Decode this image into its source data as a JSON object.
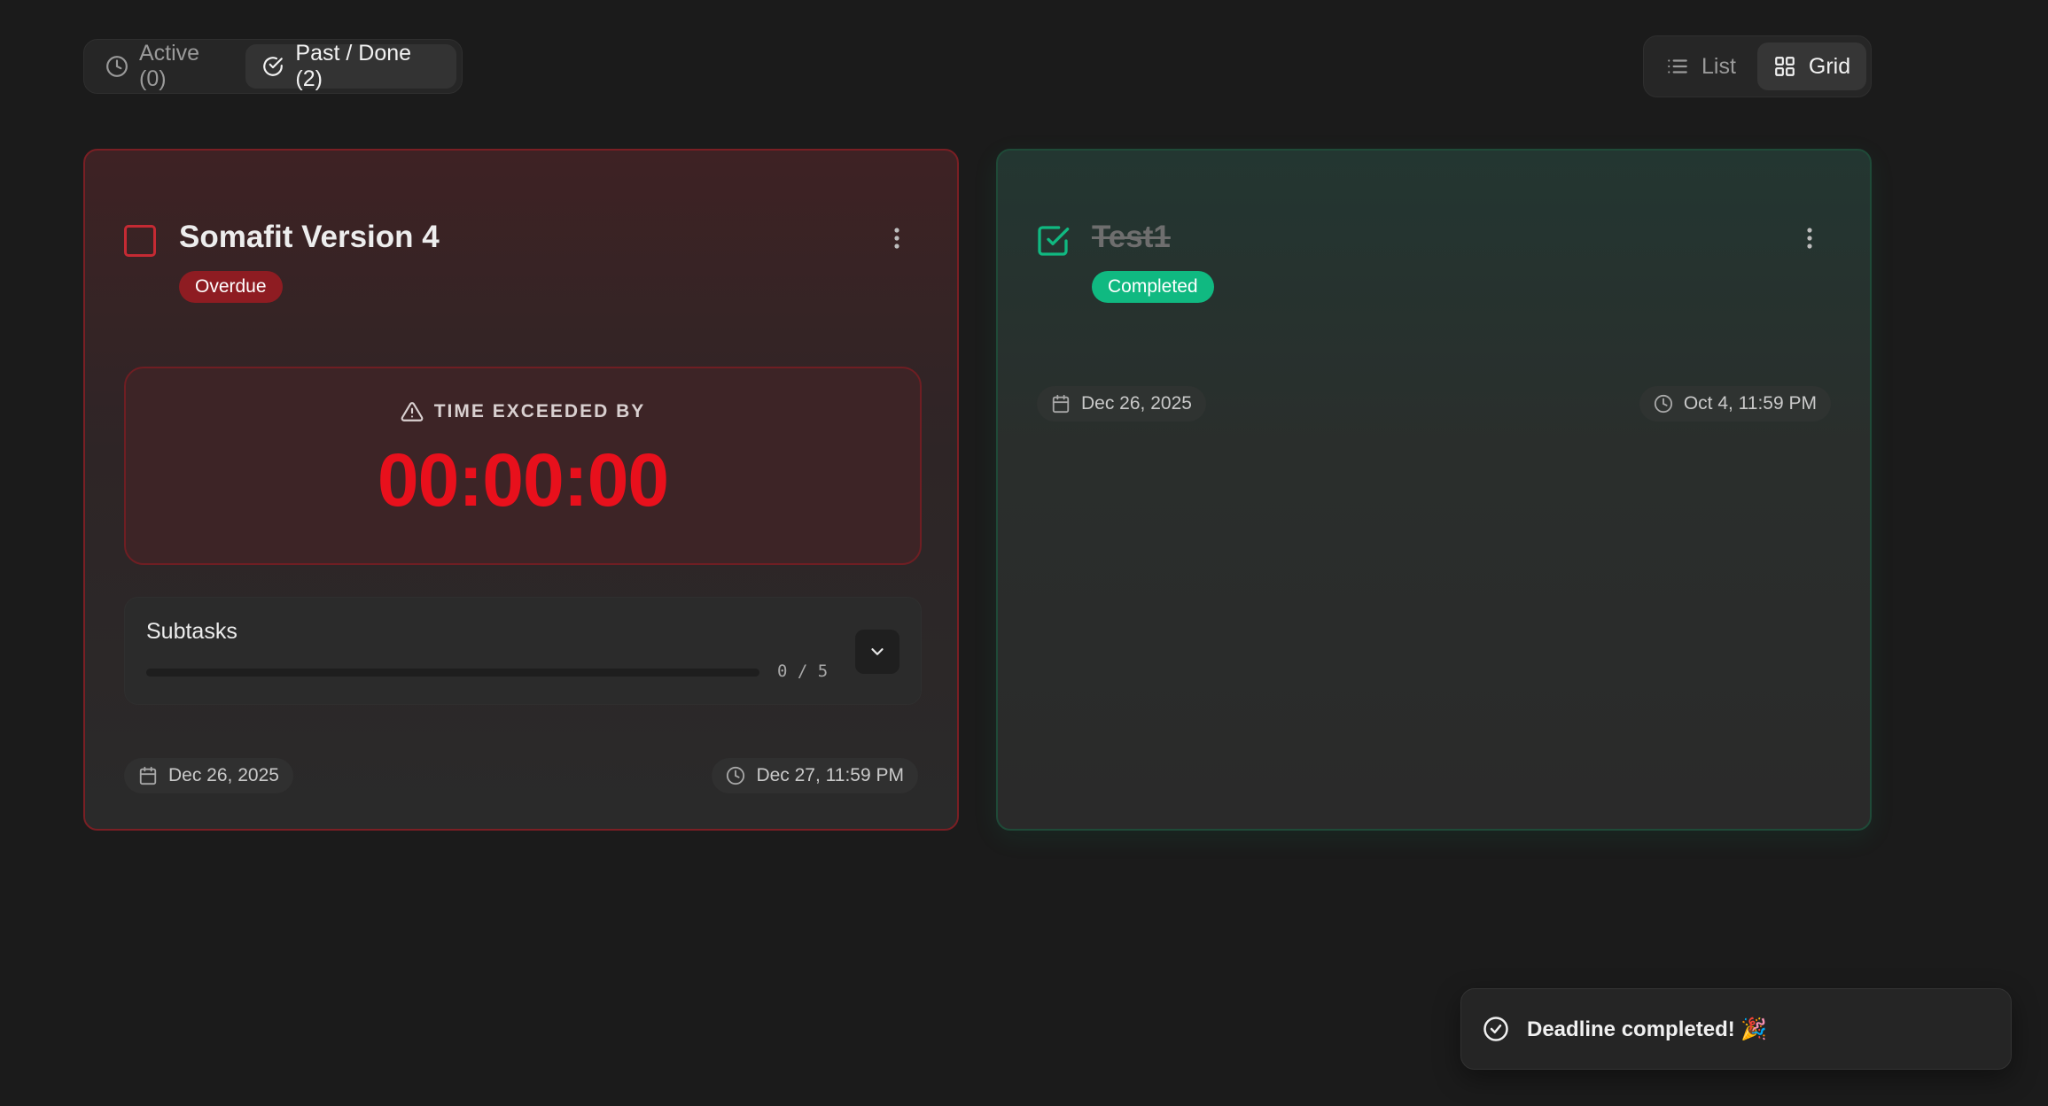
{
  "filters": {
    "active_label": "Active (0)",
    "past_label": "Past / Done (2)",
    "selected": "past"
  },
  "view_toggle": {
    "list_label": "List",
    "grid_label": "Grid",
    "selected": "grid"
  },
  "cards": [
    {
      "title": "Somafit Version 4",
      "status": "Overdue",
      "checked": false,
      "countdown_label": "TIME EXCEEDED BY",
      "countdown_value": "00:00:00",
      "subtasks_title": "Subtasks",
      "subtasks_progress": "0 / 5",
      "subtasks_done": 0,
      "subtasks_total": 5,
      "date": "Dec 26, 2025",
      "deadline": "Dec 27, 11:59 PM"
    },
    {
      "title": "Test1",
      "status": "Completed",
      "checked": true,
      "date": "Dec 26, 2025",
      "deadline": "Oct 4, 11:59 PM"
    }
  ],
  "toast": {
    "message": "Deadline completed! 🎉"
  },
  "colors": {
    "background": "#1b1b1b",
    "overdue_red": "#e8101c",
    "completed_green": "#10b981"
  },
  "icons": [
    "clock-icon",
    "check-circle-icon",
    "list-icon",
    "grid-icon",
    "more-vertical-icon",
    "alert-triangle-icon",
    "chevron-down-icon",
    "calendar-icon",
    "check-square-icon"
  ]
}
